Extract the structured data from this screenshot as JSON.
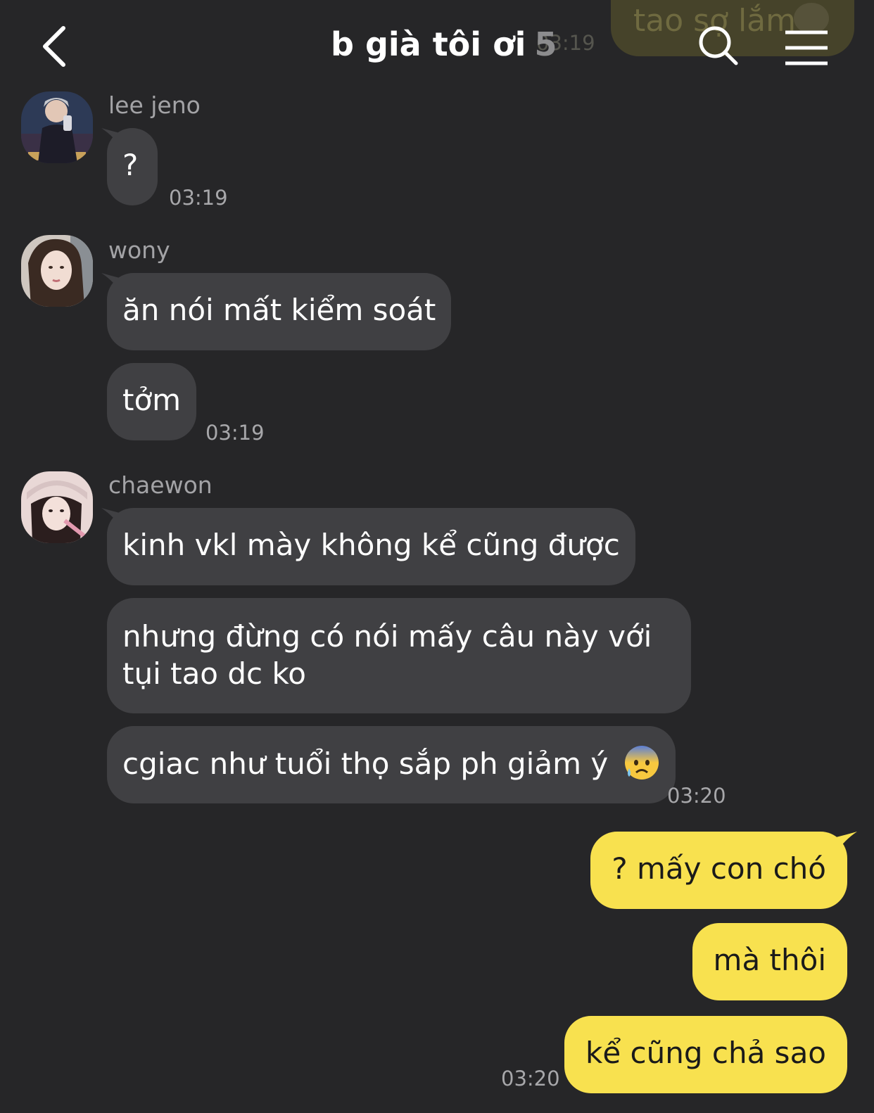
{
  "header": {
    "title": "b già tôi ơi",
    "member_count": "5",
    "previous_message_peek": "tao sợ lắm",
    "previous_message_time": "03:19"
  },
  "messages": [
    {
      "sender": "lee jeno",
      "avatar": "avatar-photo-man-mirror",
      "bubbles": [
        "?"
      ],
      "time": "03:19"
    },
    {
      "sender": "wony",
      "avatar": "avatar-photo-woman-portrait",
      "bubbles": [
        "ăn nói mất kiểm soát",
        "tởm"
      ],
      "time": "03:19"
    },
    {
      "sender": "chaewon",
      "avatar": "avatar-photo-woman-hat",
      "bubbles": [
        "kinh vkl mày không kể cũng được",
        "nhưng đừng có nói mấy câu này với tụi tao dc ko",
        "cgiac như tuổi thọ sắp ph giảm ý"
      ],
      "emoji": "anxious-face-with-sweat-icon",
      "time": "03:20"
    }
  ],
  "own_messages": {
    "bubbles": [
      "? mấy con chó",
      "mà thôi",
      "kể cũng chả sao"
    ],
    "time": "03:20"
  },
  "colors": {
    "background": "#262628",
    "incoming_bubble": "#404043",
    "outgoing_bubble": "#f8e14f",
    "meta_text": "#a7a7aa"
  }
}
